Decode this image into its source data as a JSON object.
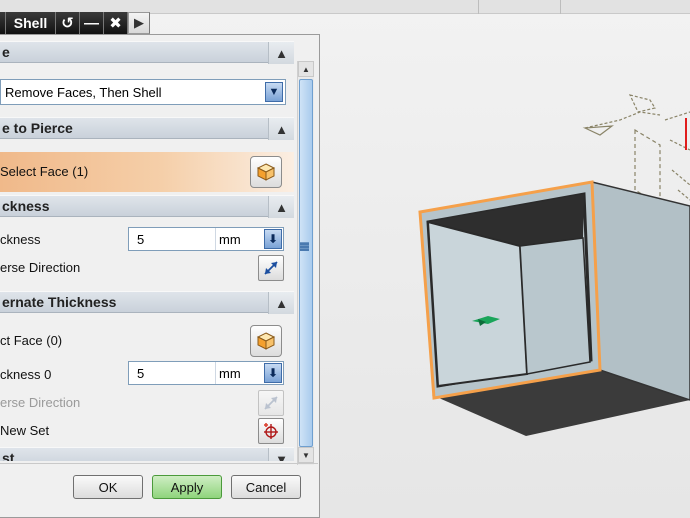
{
  "dialog": {
    "title": "Shell",
    "title_buttons": {
      "reset": "↺",
      "minimize": "—",
      "close": "✖",
      "collapse_arrow": "▶"
    },
    "sections": {
      "type": {
        "header": "e",
        "select_value": "Remove Faces, Then Shell",
        "dropdown_icon": "▼"
      },
      "face_to_pierce": {
        "header": "e to Pierce",
        "select_face_label": "Select Face (1)"
      },
      "thickness": {
        "header": "ckness",
        "thickness_label": "ckness",
        "thickness_value": "5",
        "unit": "mm",
        "reverse_label": "erse Direction"
      },
      "alternate_thickness": {
        "header": "ernate Thickness",
        "select_face_label": "ct Face (0)",
        "thickness_label": "ckness 0",
        "thickness_value": "5",
        "unit": "mm",
        "reverse_label": "erse Direction",
        "new_set_label": "New Set"
      },
      "settings": {
        "header": "st"
      }
    },
    "footer": {
      "ok": "OK",
      "apply": "Apply",
      "cancel": "Cancel"
    },
    "chevrons": {
      "up": "▲",
      "down": "▼"
    }
  },
  "icons": {
    "reset": "reset-icon",
    "cube": "cube-face-icon",
    "reverse": "reverse-direction-icon",
    "new_set": "add-new-set-icon",
    "wcs": "csys-icon"
  },
  "colors": {
    "selection_highlight": "#f5a04a",
    "part_face": "#b8c6cc",
    "part_dark": "#3a3a3a",
    "arrow": "#1aa55a",
    "apply_button": "#8fd47c"
  }
}
